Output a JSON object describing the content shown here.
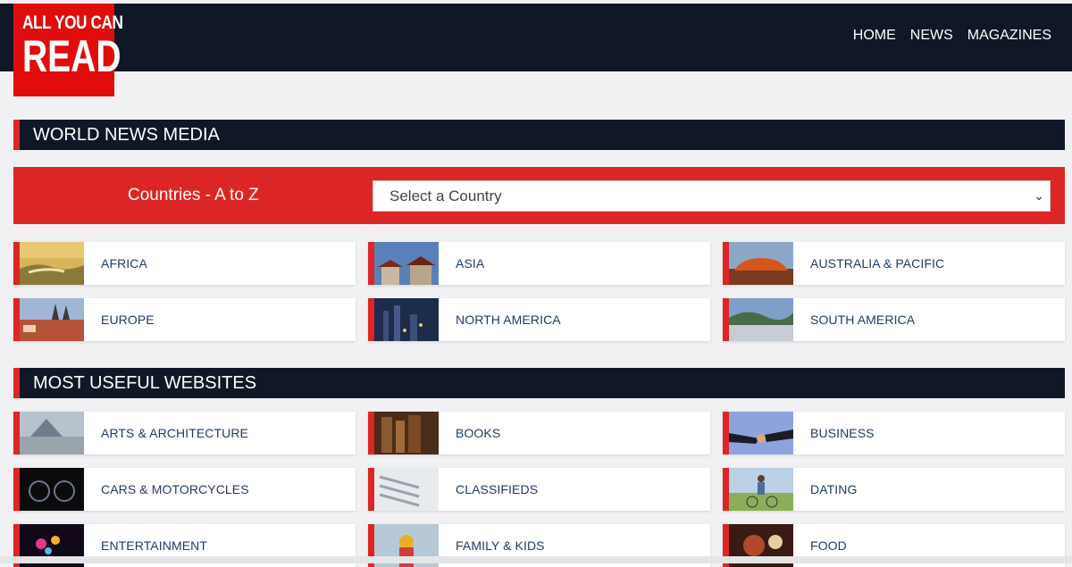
{
  "brand": {
    "logo_line1": "ALL YOU CAN",
    "logo_line2": "READ",
    "color": "#e00d0d"
  },
  "nav": {
    "items": [
      "HOME",
      "NEWS",
      "MAGAZINES"
    ]
  },
  "sections": {
    "world_news": "WORLD NEWS MEDIA",
    "useful": "MOST USEFUL WEBSITES"
  },
  "countries": {
    "label": "Countries - A to Z",
    "select_value": "Select a Country"
  },
  "regions": [
    "AFRICA",
    "ASIA",
    "AUSTRALIA & PACIFIC",
    "EUROPE",
    "NORTH AMERICA",
    "SOUTH AMERICA"
  ],
  "websites": [
    "ARTS & ARCHITECTURE",
    "BOOKS",
    "BUSINESS",
    "CARS & MOTORCYCLES",
    "CLASSIFIEDS",
    "DATING",
    "ENTERTAINMENT",
    "FAMILY & KIDS",
    "FOOD"
  ],
  "colors": {
    "dark": "#101828",
    "accent": "#dc2626",
    "link": "#1e3a5f"
  }
}
